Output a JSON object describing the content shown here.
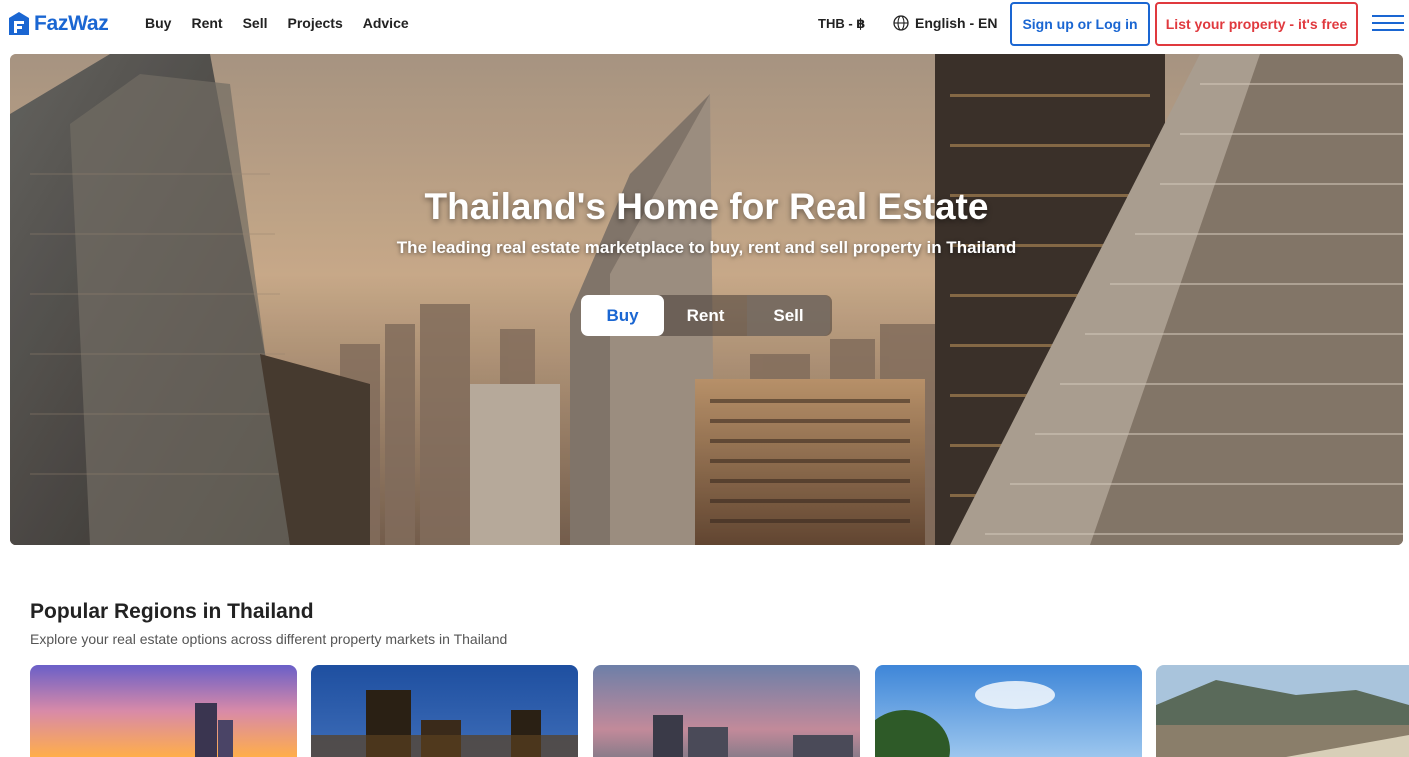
{
  "header": {
    "logo_text": "FazWaz",
    "nav": [
      "Buy",
      "Rent",
      "Sell",
      "Projects",
      "Advice"
    ],
    "currency": "THB - ฿",
    "language": "English - EN",
    "login_label": "Sign up or Log in",
    "list_label": "List your property - it's free"
  },
  "hero": {
    "title": "Thailand's Home for Real Estate",
    "subtitle": "The leading real estate marketplace to buy, rent and sell property in Thailand",
    "tabs": [
      "Buy",
      "Rent",
      "Sell"
    ],
    "active_tab": "Buy"
  },
  "regions": {
    "title": "Popular Regions in Thailand",
    "subtitle": "Explore your real estate options across different property markets in Thailand"
  },
  "colors": {
    "brand": "#1a66d2",
    "accent_red": "#e0393e"
  }
}
